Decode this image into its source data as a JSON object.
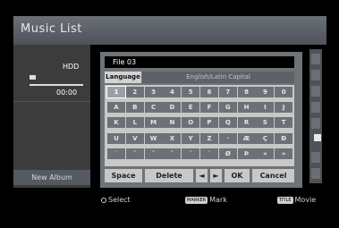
{
  "screen": {
    "title": "Music List"
  },
  "left": {
    "hdd": "HDD",
    "time": "00:00",
    "new_album": "New Album"
  },
  "dialog": {
    "file_name": "File 03",
    "language_label": "Language",
    "language_value": "English/Latin Capital",
    "keys": [
      [
        "1",
        "2",
        "3",
        "4",
        "5",
        "6",
        "7",
        "8",
        "9",
        "0"
      ],
      [
        "A",
        "B",
        "C",
        "D",
        "E",
        "F",
        "G",
        "H",
        "I",
        "J"
      ],
      [
        "K",
        "L",
        "M",
        "N",
        "O",
        "P",
        "Q",
        "R",
        "S",
        "T"
      ],
      [
        "U",
        "V",
        "W",
        "X",
        "Y",
        "Z",
        "·",
        "Æ",
        "Ç",
        "Ð"
      ],
      [
        "˙",
        "¨",
        "˜",
        "˜",
        "¨",
        "˙",
        "Ø",
        "Þ",
        "«",
        "»"
      ]
    ],
    "actions": {
      "space": "Space",
      "delete": "Delete",
      "left": "◄",
      "right": "►",
      "ok": "OK",
      "cancel": "Cancel"
    }
  },
  "footer": {
    "select": "Select",
    "marker_badge": "MARKER",
    "mark": "Mark",
    "title_badge": "TITLE",
    "movie": "Movie"
  }
}
